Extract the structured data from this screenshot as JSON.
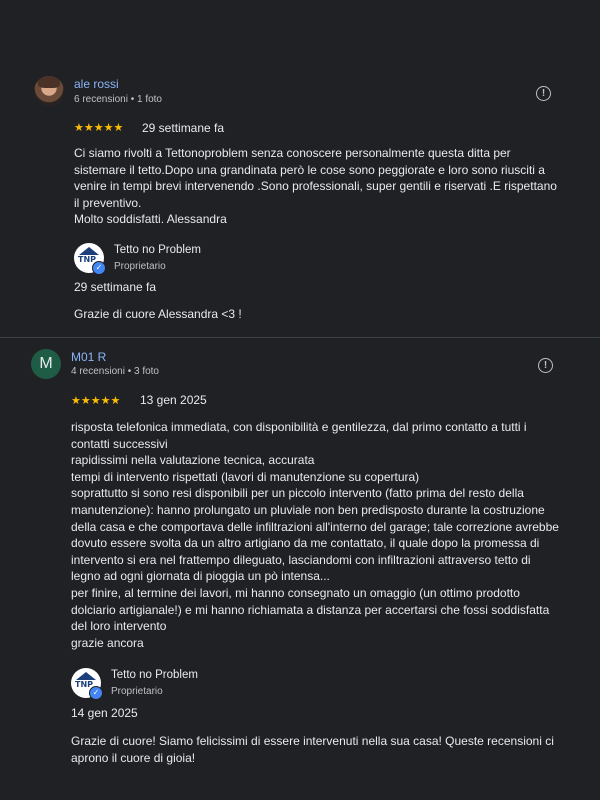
{
  "reviews": [
    {
      "author": "ale rossi",
      "meta": "6 recensioni • 1 foto",
      "stars": "★★★★★",
      "date": "29 settimane fa",
      "text": "Ci siamo rivolti a Tettonoproblem senza conoscere personalmente questa ditta per\nsistemare il tetto.Dopo una grandinata però le cose sono peggiorate e loro sono riusciti a\nvenire in tempi brevi intervenendo .Sono professionali, super gentili e riservati .E rispettano\nil preventivo.\nMolto soddisfatti. Alessandra",
      "reply": {
        "owner_name": "Tetto no Problem",
        "owner_role": "Proprietario",
        "logo_text": "TNP",
        "date": "29 settimane fa",
        "text": "Grazie di cuore Alessandra <3 !"
      }
    },
    {
      "author": "M01 R",
      "avatar_letter": "M",
      "meta": "4 recensioni • 3 foto",
      "stars": "★★★★★",
      "date": "13 gen 2025",
      "text": "risposta telefonica immediata, con disponibilità e gentilezza, dal primo contatto a tutti i\ncontatti successivi\nrapidissimi nella valutazione tecnica, accurata\ntempi di intervento rispettati (lavori di manutenzione su copertura)\nsoprattutto si sono resi disponibili per un piccolo intervento (fatto prima del resto della\nmanutenzione): hanno prolungato un pluviale non ben predisposto durante la costruzione\ndella casa e che comportava delle infiltrazioni all'interno del garage; tale correzione avrebbe\ndovuto essere svolta da un altro artigiano da me contattato, il quale dopo la promessa di\nintervento si era nel frattempo dileguato, lasciandomi con infiltrazioni attraverso tetto di\nlegno ad ogni giornata di pioggia un pò intensa...\nper finire, al termine dei lavori, mi hanno consegnato un omaggio (un ottimo prodotto\ndolciario artigianale!) e mi hanno richiamata a distanza per accertarsi che fossi soddisfatta\ndel loro intervento\ngrazie ancora",
      "reply": {
        "owner_name": "Tetto no Problem",
        "owner_role": "Proprietario",
        "logo_text": "TNP",
        "date": "14 gen 2025",
        "text": "Grazie di cuore! Siamo felicissimi di essere intervenuti nella sua casa! Queste recensioni ci\naprono il cuore di gioia!"
      }
    }
  ],
  "icons": {
    "info": "info-icon",
    "verified": "verified-check-icon"
  },
  "colors": {
    "background": "#202124",
    "author_link": "#8ab4f8",
    "star": "#fbbc04",
    "verified": "#4285f4"
  }
}
